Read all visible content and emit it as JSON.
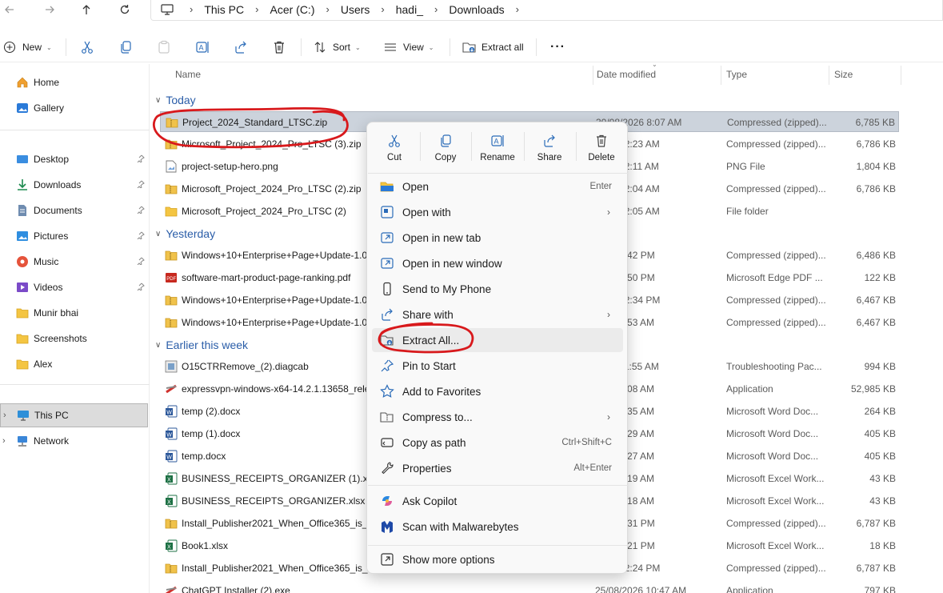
{
  "breadcrumb": [
    "This PC",
    "Acer (C:)",
    "Users",
    "hadi_",
    "Downloads"
  ],
  "commands": {
    "new": "New",
    "sort": "Sort",
    "view": "View",
    "extract_all": "Extract all"
  },
  "sidebar": {
    "items": [
      {
        "label": "Home",
        "icon": "home-icon"
      },
      {
        "label": "Gallery",
        "icon": "gallery-icon"
      },
      {
        "label": "Desktop",
        "icon": "desktop-icon",
        "pinned": true
      },
      {
        "label": "Downloads",
        "icon": "download-icon",
        "pinned": true
      },
      {
        "label": "Documents",
        "icon": "documents-icon",
        "pinned": true
      },
      {
        "label": "Pictures",
        "icon": "pictures-icon",
        "pinned": true
      },
      {
        "label": "Music",
        "icon": "music-icon",
        "pinned": true
      },
      {
        "label": "Videos",
        "icon": "videos-icon",
        "pinned": true
      },
      {
        "label": "Munir bhai",
        "icon": "folder-icon"
      },
      {
        "label": "Screenshots",
        "icon": "folder-icon"
      },
      {
        "label": "Alex",
        "icon": "folder-icon"
      },
      {
        "label": "This PC",
        "icon": "pc-icon",
        "selected": true
      },
      {
        "label": "Network",
        "icon": "network-icon"
      }
    ]
  },
  "columns": {
    "name": "Name",
    "date": "Date modified",
    "type": "Type",
    "size": "Size"
  },
  "groups": {
    "today": "Today",
    "yesterday": "Yesterday",
    "earlier": "Earlier this week"
  },
  "files": [
    {
      "name": "Project_2024_Standard_LTSC.zip",
      "date": "30/08/2026 8:07 AM",
      "type": "Compressed (zipped)...",
      "size": "6,785 KB",
      "icon": "zip-icon",
      "selected": true
    },
    {
      "name": "Microsoft_Project_2024_Pro_LTSC (3).zip",
      "date": "2026 12:23 AM",
      "type": "Compressed (zipped)...",
      "size": "6,786 KB",
      "icon": "zip-icon"
    },
    {
      "name": "project-setup-hero.png",
      "date": "2026 12:11 AM",
      "type": "PNG File",
      "size": "1,804 KB",
      "icon": "image-icon"
    },
    {
      "name": "Microsoft_Project_2024_Pro_LTSC (2).zip",
      "date": "2026 12:04 AM",
      "type": "Compressed (zipped)...",
      "size": "6,786 KB",
      "icon": "zip-icon"
    },
    {
      "name": "Microsoft_Project_2024_Pro_LTSC (2)",
      "date": "2026 12:05 AM",
      "type": "File folder",
      "size": "",
      "icon": "folder-icon"
    },
    {
      "name": "Windows+10+Enterprise+Page+Update-1.0...",
      "date": "2026 5:42 PM",
      "type": "Compressed (zipped)...",
      "size": "6,486 KB",
      "icon": "zip-icon"
    },
    {
      "name": "software-mart-product-page-ranking.pdf",
      "date": "2026 1:50 PM",
      "type": "Microsoft Edge PDF ...",
      "size": "122 KB",
      "icon": "pdf-icon"
    },
    {
      "name": "Windows+10+Enterprise+Page+Update-1.0...",
      "date": "2026 12:34 PM",
      "type": "Compressed (zipped)...",
      "size": "6,467 KB",
      "icon": "zip-icon"
    },
    {
      "name": "Windows+10+Enterprise+Page+Update-1.0...",
      "date": "2026 9:53 AM",
      "type": "Compressed (zipped)...",
      "size": "6,467 KB",
      "icon": "zip-icon"
    },
    {
      "name": "O15CTRRemove_(2).diagcab",
      "date": "2026 11:55 AM",
      "type": "Troubleshooting Pac...",
      "size": "994 KB",
      "icon": "diag-icon"
    },
    {
      "name": "expressvpn-windows-x64-14.2.1.13658_release",
      "date": "2026 9:08 AM",
      "type": "Application",
      "size": "52,985 KB",
      "icon": "app-icon"
    },
    {
      "name": "temp (2).docx",
      "date": "2026 7:35 AM",
      "type": "Microsoft Word Doc...",
      "size": "264 KB",
      "icon": "word-icon"
    },
    {
      "name": "temp (1).docx",
      "date": "2026 7:29 AM",
      "type": "Microsoft Word Doc...",
      "size": "405 KB",
      "icon": "word-icon"
    },
    {
      "name": "temp.docx",
      "date": "2026 7:27 AM",
      "type": "Microsoft Word Doc...",
      "size": "405 KB",
      "icon": "word-icon"
    },
    {
      "name": "BUSINESS_RECEIPTS_ORGANIZER (1).xlsx",
      "date": "2026 7:19 AM",
      "type": "Microsoft Excel Work...",
      "size": "43 KB",
      "icon": "excel-icon"
    },
    {
      "name": "BUSINESS_RECEIPTS_ORGANIZER.xlsx",
      "date": "2026 7:18 AM",
      "type": "Microsoft Excel Work...",
      "size": "43 KB",
      "icon": "excel-icon"
    },
    {
      "name": "Install_Publisher2021_When_Office365_is_installed",
      "date": "2026 6:31 PM",
      "type": "Compressed (zipped)...",
      "size": "6,787 KB",
      "icon": "zip-icon"
    },
    {
      "name": "Book1.xlsx",
      "date": "2026 4:21 PM",
      "type": "Microsoft Excel Work...",
      "size": "18 KB",
      "icon": "excel-icon"
    },
    {
      "name": "Install_Publisher2021_When_Office365_is_installed",
      "date": "2026 12:24 PM",
      "type": "Compressed (zipped)...",
      "size": "6,787 KB",
      "icon": "zip-icon"
    },
    {
      "name": "ChatGPT Installer (2).exe",
      "date": "25/08/2026 10:47 AM",
      "type": "Application",
      "size": "797 KB",
      "icon": "app-icon"
    }
  ],
  "context_menu": {
    "quick_actions": [
      "Cut",
      "Copy",
      "Rename",
      "Share",
      "Delete"
    ],
    "items": [
      {
        "label": "Open",
        "accel": "Enter",
        "icon": "folder-open-icon"
      },
      {
        "label": "Open with",
        "submenu": true,
        "icon": "open-with-icon"
      },
      {
        "label": "Open in new tab",
        "icon": "new-tab-icon"
      },
      {
        "label": "Open in new window",
        "icon": "new-window-icon"
      },
      {
        "label": "Send to My Phone",
        "icon": "phone-icon"
      },
      {
        "label": "Share with",
        "submenu": true,
        "icon": "share-with-icon"
      },
      {
        "label": "Extract All...",
        "icon": "extract-icon",
        "highlighted": true
      },
      {
        "label": "Pin to Start",
        "icon": "pin-icon"
      },
      {
        "label": "Add to Favorites",
        "icon": "star-icon"
      },
      {
        "label": "Compress to...",
        "submenu": true,
        "icon": "compress-icon"
      },
      {
        "label": "Copy as path",
        "accel": "Ctrl+Shift+C",
        "icon": "copy-path-icon"
      },
      {
        "label": "Properties",
        "accel": "Alt+Enter",
        "icon": "properties-icon"
      },
      {
        "label": "Ask Copilot",
        "icon": "copilot-icon"
      },
      {
        "label": "Scan with Malwarebytes",
        "icon": "malwarebytes-icon"
      },
      {
        "label": "Show more options",
        "icon": "more-options-icon"
      }
    ]
  },
  "colors": {
    "accent": "#2a5da8",
    "selection": "#ccd3dc",
    "annotation": "#d8191c"
  }
}
